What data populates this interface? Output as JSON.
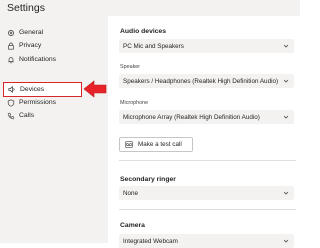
{
  "window": {
    "title": "Settings"
  },
  "sidebar": {
    "items": [
      {
        "label": "General",
        "icon": "gear-icon"
      },
      {
        "label": "Privacy",
        "icon": "lock-icon"
      },
      {
        "label": "Notifications",
        "icon": "bell-icon"
      },
      {
        "label": "Devices",
        "icon": "speaker-icon",
        "active": true
      },
      {
        "label": "Permissions",
        "icon": "shield-icon"
      },
      {
        "label": "Calls",
        "icon": "phone-icon"
      }
    ],
    "highlight_color": "#d6262b"
  },
  "main": {
    "audio_devices": {
      "heading": "Audio devices",
      "selected": "PC Mic and Speakers"
    },
    "speaker": {
      "label": "Speaker",
      "selected": "Speakers / Headphones (Realtek High Definition Audio)"
    },
    "microphone": {
      "label": "Microphone",
      "selected": "Microphone Array (Realtek High Definition Audio)"
    },
    "test_call": {
      "label": "Make a test call",
      "icon": "test-call-icon"
    },
    "secondary_ringer": {
      "heading": "Secondary ringer",
      "selected": "None"
    },
    "camera": {
      "heading": "Camera",
      "selected": "Integrated Webcam"
    }
  }
}
